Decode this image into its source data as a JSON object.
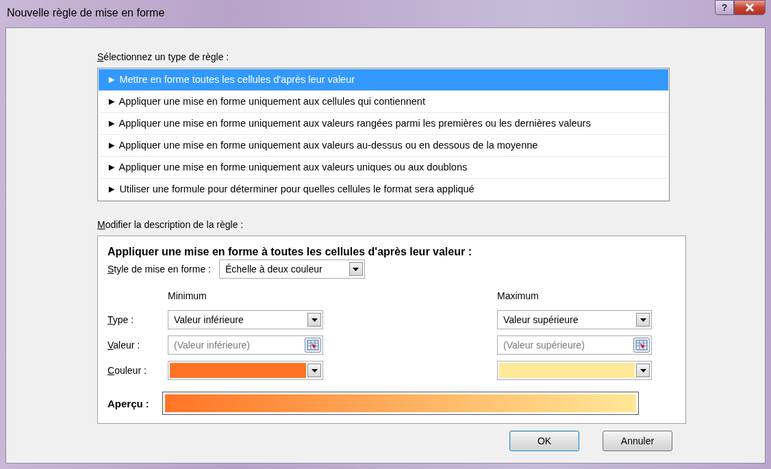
{
  "window": {
    "title": "Nouvelle règle de mise en forme",
    "help": "?"
  },
  "rule_types": {
    "label": "Sélectionnez un type de règle :",
    "items": [
      {
        "label": "► Mettre en forme toutes les cellules d'après leur valeur",
        "selected": true
      },
      {
        "label": "► Appliquer une mise en forme uniquement aux cellules qui contiennent",
        "selected": false
      },
      {
        "label": "► Appliquer une mise en forme uniquement aux valeurs rangées parmi les premières ou les dernières valeurs",
        "selected": false
      },
      {
        "label": "► Appliquer une mise en forme uniquement aux valeurs au-dessus ou en dessous de la moyenne",
        "selected": false
      },
      {
        "label": "► Appliquer une mise en forme uniquement aux valeurs uniques ou aux doublons",
        "selected": false
      },
      {
        "label": "► Utiliser une formule pour déterminer pour quelles cellules le format sera appliqué",
        "selected": false
      }
    ]
  },
  "description": {
    "label": "Modifier la description de la règle :",
    "heading": "Appliquer une mise en forme à toutes les cellules d'après leur valeur :",
    "style_label": "Style de mise en forme :",
    "style_value": "Échelle à deux couleur",
    "type_label": "Type :",
    "value_label": "Valeur :",
    "color_label": "Couleur :",
    "bounds": [
      {
        "heading": "Minimum",
        "type": "Valeur inférieure",
        "value_placeholder": "(Valeur inférieure)",
        "color": "#ff7424"
      },
      {
        "heading": "Maximum",
        "type": "Valeur supérieure",
        "value_placeholder": "(Valeur supérieure)",
        "color": "#ffe998"
      }
    ],
    "preview_label": "Aperçu :"
  },
  "buttons": [
    {
      "label": "OK",
      "default": true
    },
    {
      "label": "Annuler",
      "default": false
    }
  ]
}
